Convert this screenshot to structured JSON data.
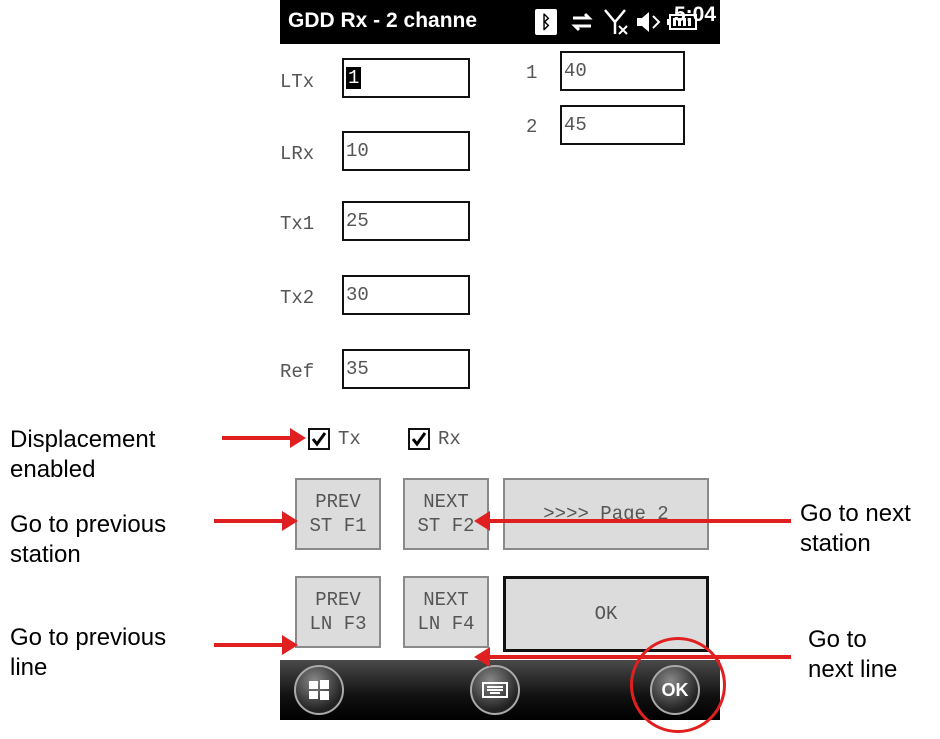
{
  "status_bar": {
    "title": "GDD Rx - 2 channe",
    "time": "5:04",
    "icons": [
      "bluetooth-icon",
      "sync-icon",
      "no-signal-icon",
      "volume-icon",
      "battery-icon"
    ]
  },
  "fields": {
    "ltx": {
      "label": "LTx",
      "value": "1"
    },
    "lrx": {
      "label": "LRx",
      "value": "10"
    },
    "tx1": {
      "label": "Tx1",
      "value": "25"
    },
    "tx2": {
      "label": "Tx2",
      "value": "30"
    },
    "ref": {
      "label": "Ref",
      "value": "35"
    },
    "ch1": {
      "label": "1",
      "value": "40"
    },
    "ch2": {
      "label": "2",
      "value": "45"
    }
  },
  "checkboxes": {
    "tx": {
      "label": "Tx",
      "checked": true
    },
    "rx": {
      "label": "Rx",
      "checked": true
    }
  },
  "buttons": {
    "prev_st": {
      "line1": "PREV",
      "line2": "ST F1"
    },
    "next_st": {
      "line1": "NEXT",
      "line2": "ST F2"
    },
    "prev_ln": {
      "line1": "PREV",
      "line2": "LN F3"
    },
    "next_ln": {
      "line1": "NEXT",
      "line2": "LN F4"
    },
    "page2": ">>>> Page 2",
    "ok": "OK"
  },
  "taskbar": {
    "start": "start-icon",
    "keyboard": "keyboard-icon",
    "ok": "OK"
  },
  "annotations": {
    "displacement": {
      "line1": "Displacement",
      "line2": "enabled"
    },
    "prev_station": {
      "line1": "Go to previous",
      "line2": "station"
    },
    "prev_line": {
      "line1": "Go to previous",
      "line2": "line"
    },
    "next_station": {
      "line1": "Go to next",
      "line2": "station"
    },
    "next_line": {
      "line1": "Go to",
      "line2": "next line"
    }
  },
  "colors": {
    "annotation_arrow": "#e02020"
  }
}
